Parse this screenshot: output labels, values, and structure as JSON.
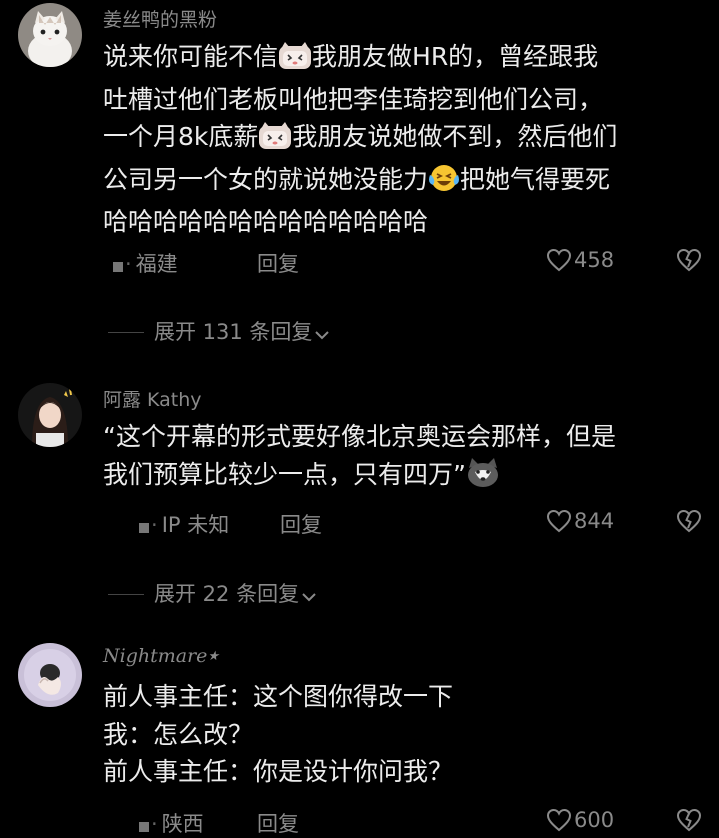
{
  "comments": [
    {
      "username": "姜丝鸭的黑粉",
      "lines": [
        [
          "说来你可能不信",
          "我朋友做HR的，曾经跟我"
        ],
        [
          "吐槽过他们老板叫他把李佳琦挖到他们公司，"
        ],
        [
          "一个月8k底薪",
          "我朋友说她做不到，然后他们"
        ],
        [
          "公司另一个女的就说她没能力",
          "把她气得要死"
        ],
        [
          "哈哈哈哈哈哈哈哈哈哈哈哈哈"
        ]
      ],
      "emoji_icons": [
        "cat-emoji",
        "cat-emoji",
        "laughing-tears-emoji"
      ],
      "location": "福建",
      "reply_label": "回复",
      "likes": "458",
      "expand_label": "展开 131 条回复"
    },
    {
      "username": "阿露 Kathy",
      "lines": [
        [
          "“这个开幕的形式要好像北京奥运会那样，但是"
        ],
        [
          "我们预算比较少一点，只有四万”"
        ]
      ],
      "emoji_icons": [
        "husky-emoji"
      ],
      "location": "IP 未知",
      "reply_label": "回复",
      "likes": "844",
      "expand_label": "展开 22 条回复"
    },
    {
      "username": "Nightmare",
      "username_suffix": "★",
      "lines": [
        [
          "前人事主任：这个图你得改一下"
        ],
        [
          "我：怎么改？"
        ],
        [
          "前人事主任：你是设计你问我？"
        ]
      ],
      "location": "陕西",
      "reply_label": "回复",
      "likes": "600"
    }
  ],
  "colors": {
    "background": "#000000",
    "primary_text": "#ececec",
    "secondary_text": "#8a8a8a"
  },
  "icons": [
    "heart-outline-icon",
    "broken-heart-icon",
    "chevron-down-icon",
    "location-icon"
  ]
}
